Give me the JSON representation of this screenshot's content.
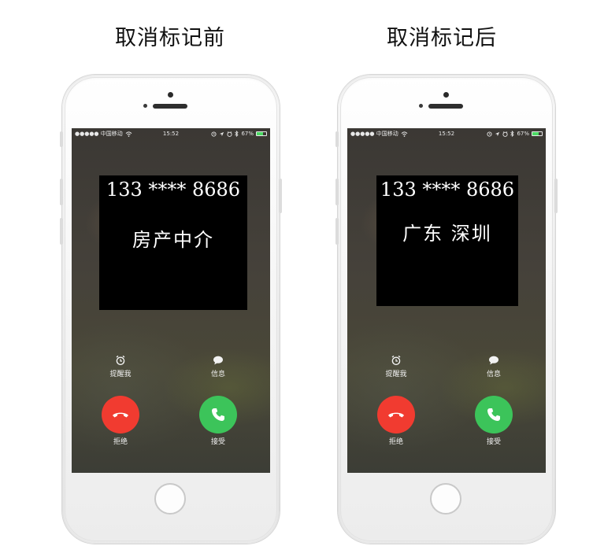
{
  "panels": [
    {
      "title": "取消标记前",
      "status_bar": {
        "carrier": "●●●●● 中国移动",
        "time": "15:52",
        "battery": "67%",
        "battery_level": 0.67
      },
      "caller": {
        "number": "133  ****  8686",
        "label": "房产中介"
      },
      "actions": {
        "remind": "提醒我",
        "message": "信息",
        "decline": "拒绝",
        "accept": "接受"
      }
    },
    {
      "title": "取消标记后",
      "status_bar": {
        "carrier": "●●●●● 中国移动",
        "time": "15:52",
        "battery": "67%",
        "battery_level": 0.67
      },
      "caller": {
        "number": "133  ****  8686",
        "label": "广东  深圳"
      },
      "actions": {
        "remind": "提醒我",
        "message": "信息",
        "decline": "拒绝",
        "accept": "接受"
      }
    }
  ],
  "colors": {
    "decline": "#f13b30",
    "accept": "#3cc45a",
    "battery": "#4cd964"
  },
  "icons": [
    "wifi-icon",
    "alarm-icon",
    "location-icon",
    "bluetooth-icon",
    "battery-icon",
    "clock-icon",
    "message-icon",
    "phone-hangup-icon",
    "phone-icon"
  ]
}
